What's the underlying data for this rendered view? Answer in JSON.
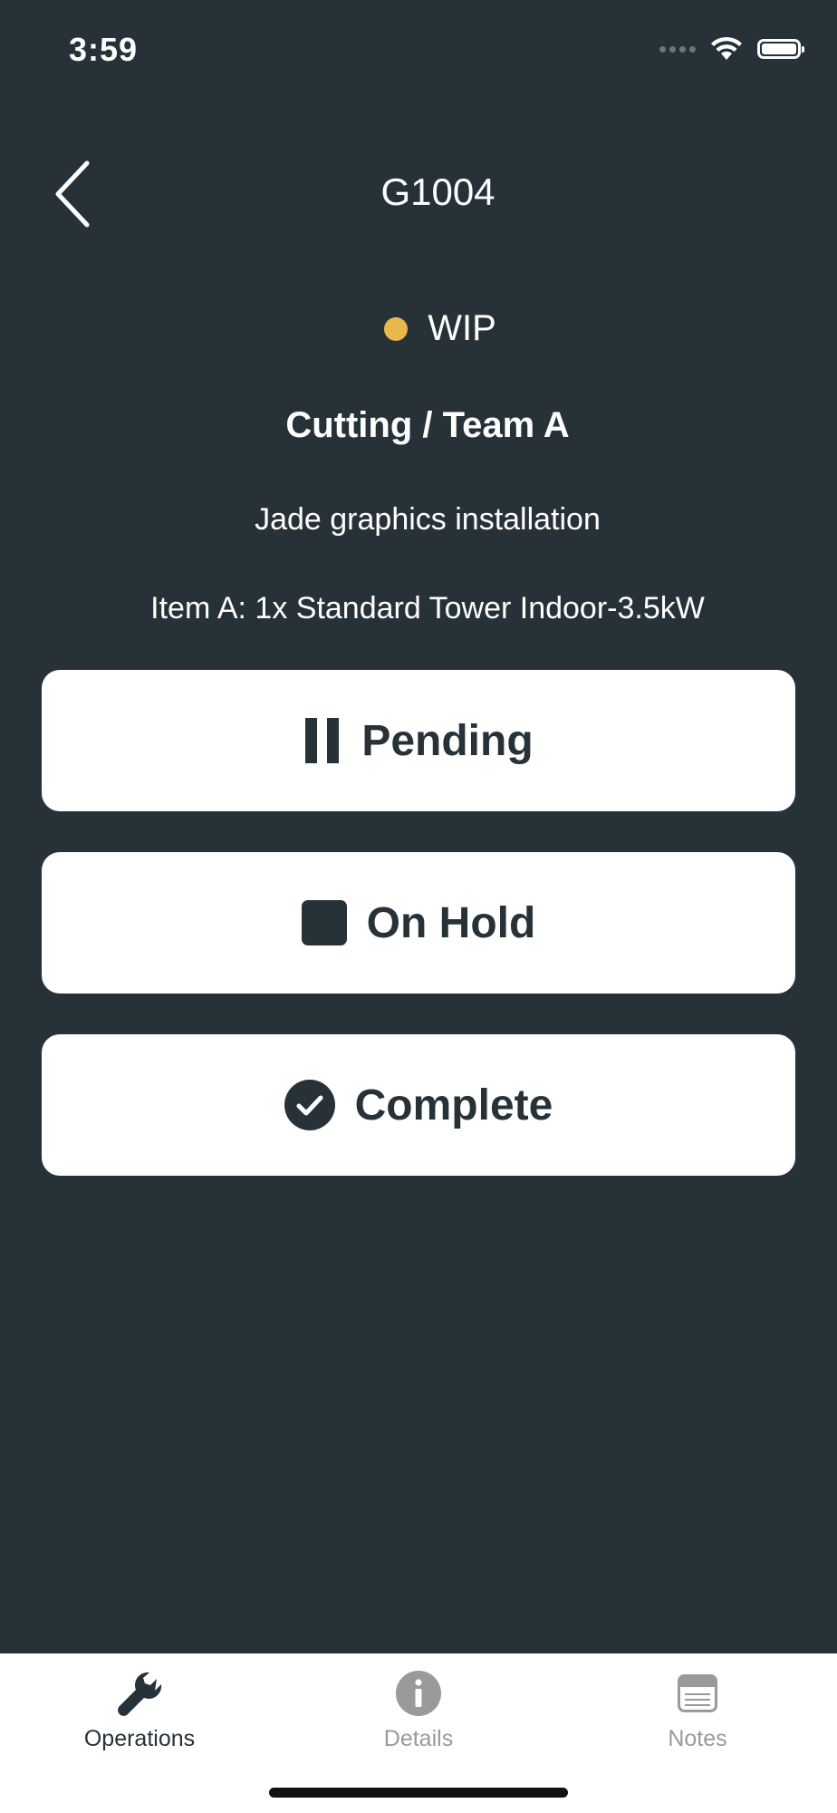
{
  "status_bar": {
    "time": "3:59"
  },
  "header": {
    "title": "G1004"
  },
  "job": {
    "status": "WIP",
    "status_color": "#e8b84b",
    "team": "Cutting / Team A",
    "description": "Jade graphics installation",
    "item": "Item A: 1x Standard Tower Indoor-3.5kW"
  },
  "actions": {
    "pending_label": "Pending",
    "hold_label": "On Hold",
    "complete_label": "Complete"
  },
  "tabs": {
    "operations_label": "Operations",
    "details_label": "Details",
    "notes_label": "Notes",
    "active": "Operations"
  },
  "colors": {
    "background": "#263238",
    "button_bg": "#ffffff",
    "button_text": "#263238",
    "inactive_tab": "#9a9a9a"
  }
}
